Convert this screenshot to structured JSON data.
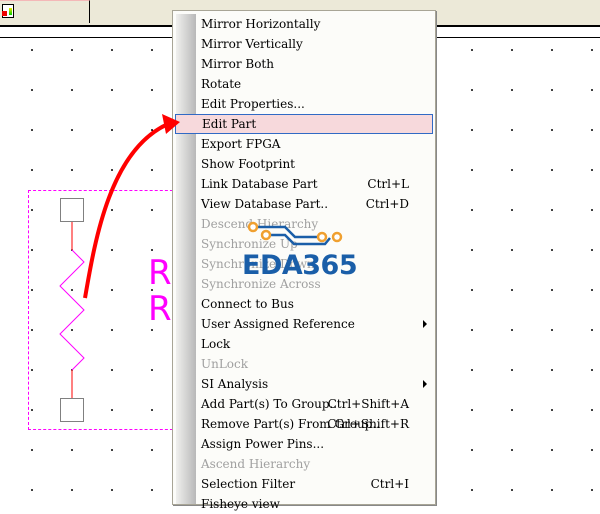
{
  "toolbar": {
    "doc_icon": "schematic-document-icon"
  },
  "schematic": {
    "refdes_lines": [
      "R",
      "R"
    ]
  },
  "menu": {
    "items": [
      {
        "label": "Mirror Horizontally",
        "shortcut": "",
        "enabled": true
      },
      {
        "label": "Mirror Vertically",
        "shortcut": "",
        "enabled": true
      },
      {
        "label": "Mirror Both",
        "shortcut": "",
        "enabled": true
      },
      {
        "label": "Rotate",
        "shortcut": "",
        "enabled": true
      },
      {
        "label": "Edit Properties...",
        "shortcut": "",
        "enabled": true
      },
      {
        "label": "Edit Part",
        "shortcut": "",
        "enabled": true,
        "highlighted": true
      },
      {
        "label": "Export FPGA",
        "shortcut": "",
        "enabled": true
      },
      {
        "label": "Show Footprint",
        "shortcut": "",
        "enabled": true
      },
      {
        "label": "Link Database Part",
        "shortcut": "Ctrl+L",
        "enabled": true
      },
      {
        "label": "View Database Part..",
        "shortcut": "Ctrl+D",
        "enabled": true
      },
      {
        "label": "Descend Hierarchy",
        "shortcut": "",
        "enabled": false
      },
      {
        "label": "Synchronize Up",
        "shortcut": "",
        "enabled": false
      },
      {
        "label": "Synchronize Down",
        "shortcut": "",
        "enabled": false
      },
      {
        "label": "Synchronize Across",
        "shortcut": "",
        "enabled": false
      },
      {
        "label": "Connect to Bus",
        "shortcut": "",
        "enabled": true
      },
      {
        "label": "User Assigned Reference",
        "shortcut": "",
        "enabled": true,
        "submenu": true
      },
      {
        "label": "Lock",
        "shortcut": "",
        "enabled": true
      },
      {
        "label": "UnLock",
        "shortcut": "",
        "enabled": false
      },
      {
        "label": "SI Analysis",
        "shortcut": "",
        "enabled": true,
        "submenu": true
      },
      {
        "label": "Add Part(s) To Group..",
        "shortcut": "Ctrl+Shift+A",
        "enabled": true
      },
      {
        "label": "Remove Part(s) From Group..",
        "shortcut": "Ctrl+Shift+R",
        "enabled": true
      },
      {
        "label": "Assign Power Pins...",
        "shortcut": "",
        "enabled": true
      },
      {
        "label": "Ascend Hierarchy",
        "shortcut": "",
        "enabled": false
      },
      {
        "label": "Selection Filter",
        "shortcut": "Ctrl+I",
        "enabled": true
      },
      {
        "label": "Fisheye view",
        "shortcut": "",
        "enabled": true
      }
    ]
  },
  "watermark": {
    "text": "EDA365",
    "color": "#1a5ea8",
    "accent": "#f0a030"
  },
  "annotation": {
    "arrow_color": "#ff0000"
  }
}
